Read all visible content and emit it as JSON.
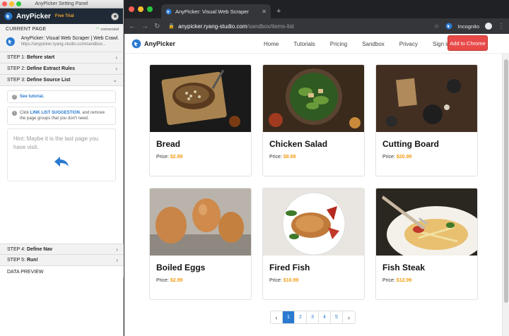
{
  "panel": {
    "window_title": "AnyPicker Setting Panel",
    "brand": "AnyPicker",
    "trial_badge": "Free Trial",
    "current_page": {
      "section_label": "CURRENT PAGE",
      "status": "connected",
      "site_title": "AnyPicker: Visual Web Scraper | Web Crawl...",
      "site_url": "https://anypicker.ryang-studio.com/sandbox..."
    },
    "steps": [
      {
        "prefix": "STEP 1:",
        "label": "Before start",
        "chevron": "›"
      },
      {
        "prefix": "STEP 2:",
        "label": "Define Extract Rules",
        "chevron": "›"
      },
      {
        "prefix": "STEP 3:",
        "label": "Define Source List",
        "chevron": "⌄"
      },
      {
        "prefix": "STEP 4:",
        "label": "Define Nav",
        "chevron": "›"
      },
      {
        "prefix": "STEP 5:",
        "label": "Run!",
        "chevron": "›"
      }
    ],
    "step3": {
      "tutorial_link": "See tutorial.",
      "instruction_prefix": "Click",
      "instruction_link": "LINK LIST SUGGESTION",
      "instruction_suffix": ", and remove the page groups that you don't need.",
      "hint": "Hint: Maybe it is the last page you have visit."
    },
    "data_preview": "DATA PREVIEW"
  },
  "browser": {
    "tab_title": "AnyPicker: Visual Web Scraper",
    "url_domain": "anypicker.ryang-studio.com",
    "url_path": "/sandbox/items-list",
    "incognito_label": "Incognito"
  },
  "site": {
    "brand": "AnyPicker",
    "nav": [
      "Home",
      "Tutorials",
      "Pricing",
      "Sandbox",
      "Privacy",
      "Sign in"
    ],
    "cta": "Add to Chrome",
    "price_label": "Price:",
    "products": [
      {
        "name": "Bread",
        "price": "$2.99"
      },
      {
        "name": "Chicken Salad",
        "price": "$8.99"
      },
      {
        "name": "Cutting Board",
        "price": "$20.99"
      },
      {
        "name": "Boiled Eggs",
        "price": "$2.99"
      },
      {
        "name": "Fired Fish",
        "price": "$10.99"
      },
      {
        "name": "Fish Steak",
        "price": "$12.99"
      }
    ],
    "pagination": {
      "prev": "‹",
      "pages": [
        "1",
        "2",
        "3",
        "4",
        "5"
      ],
      "active": "1",
      "next": "›"
    }
  },
  "colors": {
    "accent_blue": "#2a7ad1",
    "price_orange": "#f39c12",
    "cta_red": "#e84a4a",
    "panel_header": "#1f2a36"
  }
}
